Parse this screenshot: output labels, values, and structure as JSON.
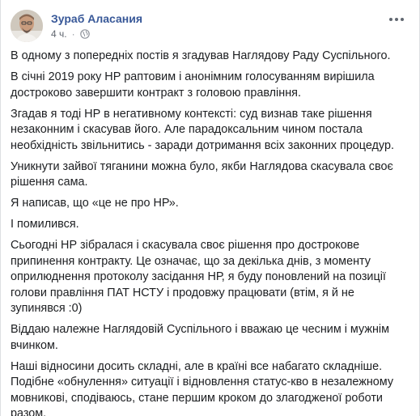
{
  "post": {
    "author": "Зураб Аласания",
    "time": "4 ч.",
    "separator": "·",
    "paragraphs": [
      "В одному з попередніх постів я згадував Наглядову Раду Суспільного.",
      "В січні 2019 року НР раптовим і анонімним голосуванням вирішила достроково завершити контракт з головою правління.",
      "Згадав я тоді НР в негативному контексті: суд визнав таке рішення незаконним і скасував його. Але парадоксальним чином постала необхідність звільнитись - заради дотримання всіх законних процедур.",
      "Уникнути зайвої тяганини можна було, якби Наглядова скасувала своє рішення сама.",
      "Я написав, що «це не про НР».",
      "І помилився.",
      "Сьогодні НР зібралася і скасувала своє рішення про дострокове припинення контракту. Це означає, що за декілька днів, з моменту оприлюднення протоколу засідання НР, я буду поновлений на позиції голови правління ПАТ НСТУ і продовжу працювати (втім, я й не зупинявся :0)",
      "Віддаю належне Наглядовій Суспільного і вважаю це чесним і мужнім вчинком.",
      "Наші відносини досить складні, але в країні все набагато складніше. Подібне «обнулення» ситуації і відновлення статус-кво в незалежному мовникові, сподіваюсь, стане першим кроком до злагодженої роботи разом."
    ]
  },
  "icons": {
    "privacy": "globe-icon",
    "menu": "more-options-icon"
  },
  "colors": {
    "author_link": "#385898",
    "meta_text": "#616770",
    "body_text": "#1c1e21"
  }
}
